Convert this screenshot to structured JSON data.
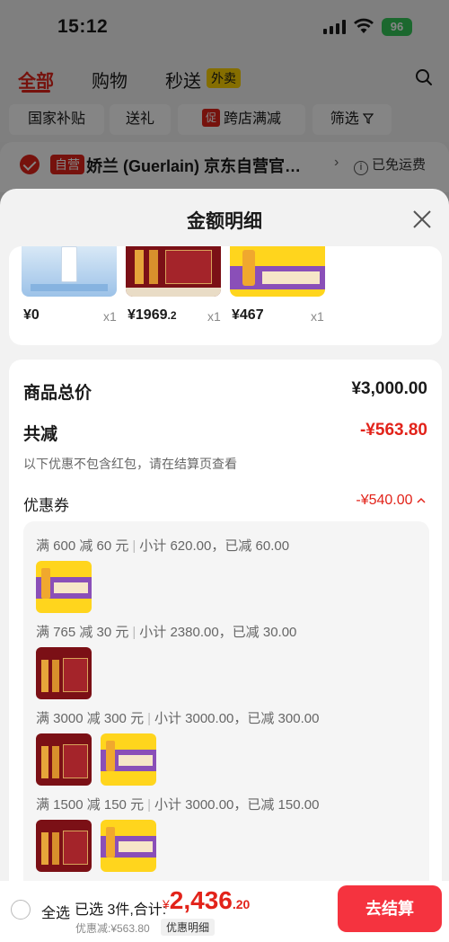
{
  "status_bar": {
    "time": "15:12",
    "battery": "96"
  },
  "tabs": [
    {
      "label": "全部"
    },
    {
      "label": "购物"
    },
    {
      "label": "秒送"
    }
  ],
  "waimai_badge": "外卖",
  "filters": [
    "国家补贴",
    "送礼",
    "跨店满减",
    "筛选"
  ],
  "filter_cu_badge": "促",
  "shop": {
    "ziying_badge": "自营",
    "name": "娇兰 (Guerlain) 京东自营官…",
    "freeship": "已免运费"
  },
  "sheet": {
    "title": "金额明细",
    "products": [
      {
        "price": "¥0",
        "price_dec": "",
        "qty": "x1"
      },
      {
        "price": "¥1969",
        "price_dec": ".2",
        "qty": "x1"
      },
      {
        "price": "¥467",
        "price_dec": "",
        "qty": "x1"
      }
    ],
    "total_label": "商品总价",
    "total_value": "¥3,000.00",
    "reduce_label": "共减",
    "reduce_value": "-¥563.80",
    "note": "以下优惠不包含红包，请在结算页查看",
    "coupon_label": "优惠券",
    "coupon_value": "-¥540.00",
    "coupon_rules": [
      {
        "rule": "满 600 减 60 元",
        "detail": "小计 620.00，已减 60.00"
      },
      {
        "rule": "满 765 减 30 元",
        "detail": "小计 2380.00，已减 30.00"
      },
      {
        "rule": "满 3000 减 300 元",
        "detail": "小计 3000.00，已减 300.00"
      },
      {
        "rule": "满 1500 减 150 元",
        "detail": "小计 3000.00，已减 150.00"
      }
    ]
  },
  "bottom": {
    "select_all": "全选",
    "summary": "已选 3件,合计:",
    "currency": "¥",
    "total_int": "2,436",
    "total_dec": ".20",
    "discount": "优惠减:¥563.80",
    "detail_tag": "优惠明细",
    "checkout": "去结算"
  },
  "colors": {
    "accent": "#e2231a",
    "checkout": "#f5333f",
    "battery": "#35c759"
  }
}
